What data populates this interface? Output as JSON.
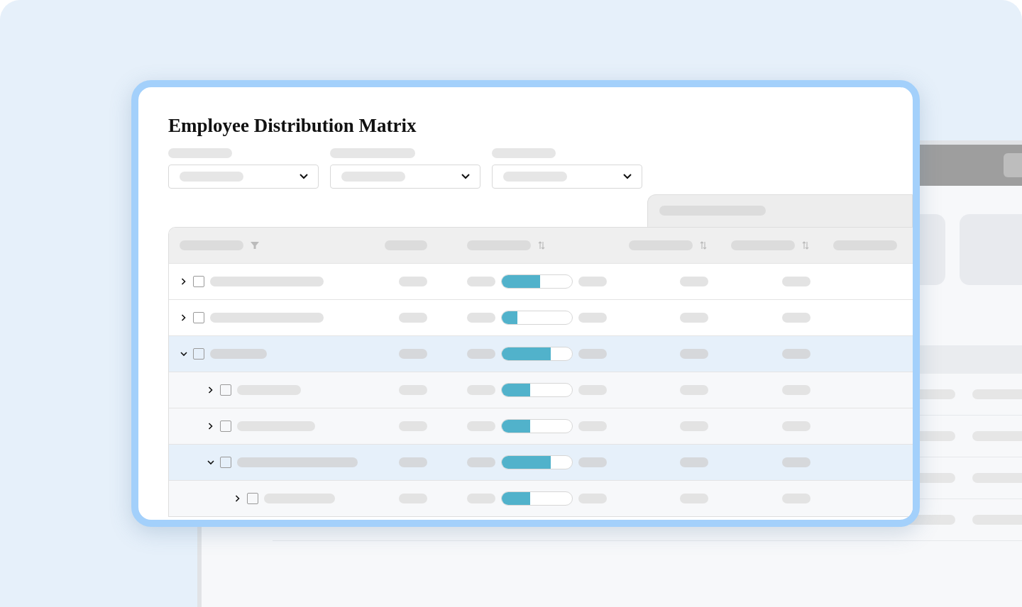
{
  "title": "Employee Distribution Matrix",
  "rows": [
    {
      "expanded": false,
      "selected": false,
      "checked": false,
      "level": 0.55
    },
    {
      "expanded": false,
      "selected": false,
      "checked": false,
      "level": 0.22
    },
    {
      "expanded": true,
      "selected": true,
      "checked": false,
      "level": 0.7,
      "children": [
        {
          "expanded": false,
          "selected": false,
          "checked": false,
          "level": 0.4
        },
        {
          "expanded": false,
          "selected": false,
          "checked": false,
          "level": 0.4
        },
        {
          "expanded": true,
          "selected": true,
          "checked": false,
          "level": 0.7,
          "children": [
            {
              "expanded": false,
              "selected": false,
              "checked": false,
              "level": 0.4
            }
          ]
        }
      ]
    }
  ]
}
